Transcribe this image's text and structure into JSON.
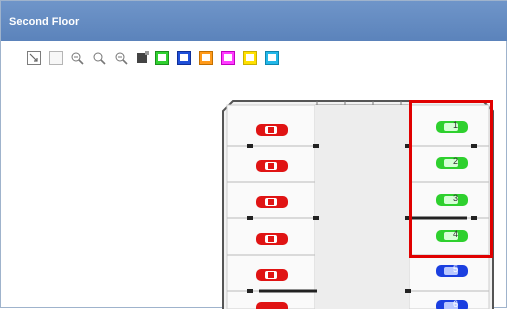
{
  "window": {
    "title": "Second Floor"
  },
  "toolbar": {
    "tools": [
      {
        "name": "select-tool-icon"
      },
      {
        "name": "area-select-tool-icon"
      },
      {
        "name": "zoom-in-icon"
      },
      {
        "name": "zoom-out-icon"
      },
      {
        "name": "zoom-fit-icon"
      },
      {
        "name": "fill-color-icon"
      }
    ],
    "flags": [
      {
        "name": "green-flag-icon",
        "color": "#2fd02f"
      },
      {
        "name": "blue-flag-icon",
        "color": "#1f4fd8"
      },
      {
        "name": "orange-flag-icon",
        "color": "#ff9a1a"
      },
      {
        "name": "pink-flag-icon",
        "color": "#ff3cff"
      },
      {
        "name": "yellow-flag-icon",
        "color": "#ffe000"
      },
      {
        "name": "cyan-flag-icon",
        "color": "#22b7e8"
      }
    ]
  },
  "parking": {
    "left_cars": [
      {
        "color": "#e01414"
      },
      {
        "color": "#e01414"
      },
      {
        "color": "#e01414"
      },
      {
        "color": "#e01414"
      },
      {
        "color": "#e01414"
      },
      {
        "color": "#e01414"
      }
    ],
    "right_spots": [
      {
        "number": "1",
        "color": "#2ed02e"
      },
      {
        "number": "2",
        "color": "#2ed02e"
      },
      {
        "number": "3",
        "color": "#2ed02e"
      },
      {
        "number": "4",
        "color": "#2ed02e"
      },
      {
        "number": "5",
        "color": "#1b3fe0"
      },
      {
        "number": "6",
        "color": "#1b3fe0"
      }
    ],
    "highlight_color": "#e00000"
  }
}
